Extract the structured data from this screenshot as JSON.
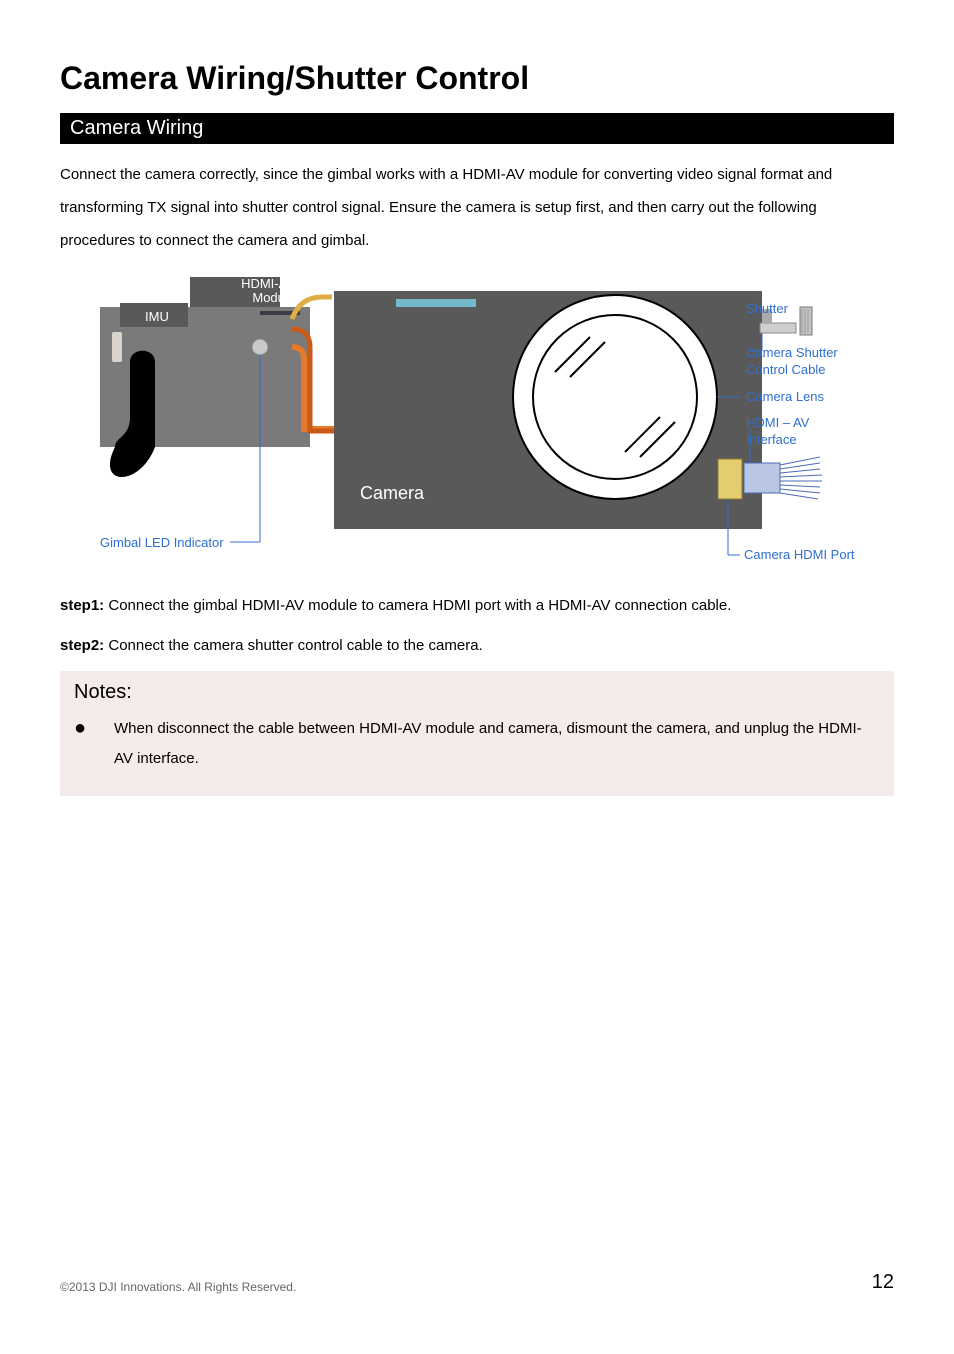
{
  "page": {
    "title": "Camera Wiring/Shutter Control",
    "section": "Camera Wiring",
    "intro": "Connect the camera correctly, since the gimbal works with a HDMI-AV module for converting video signal format and transforming TX signal into shutter control signal. Ensure the camera is setup first, and then carry out the following procedures to connect the camera and gimbal.",
    "step1_label": "step1:",
    "step1_text": " Connect the gimbal HDMI-AV module to camera HDMI port with a HDMI-AV connection cable.",
    "step2_label": "step2:",
    "step2_text": " Connect the camera shutter control cable to the camera.",
    "notes_title": "Notes:",
    "notes_item": "When disconnect the cable between HDMI-AV module and camera, dismount the camera, and unplug the HDMI-AV interface.",
    "footer_left": "©2013 DJI Innovations. All Rights Reserved.",
    "page_number": "12"
  },
  "diagram": {
    "imu": "IMU",
    "hdmi_av_module": "HDMI-AV Module",
    "camera": "Camera",
    "gimbal_led": "Gimbal LED Indicator",
    "shutter": "Shutter",
    "shutter_cable": "Camera Shutter Control Cable",
    "camera_lens": "Camera Lens",
    "hdmi_av_interface": "HDMI – AV Interface",
    "camera_hdmi_port": "Camera HDMI Port"
  }
}
